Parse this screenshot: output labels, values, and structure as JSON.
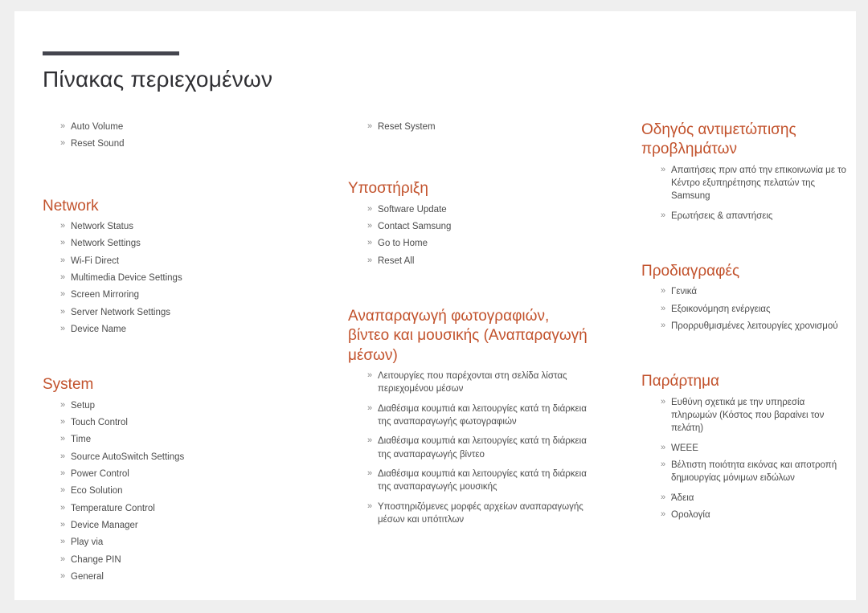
{
  "document": {
    "title": "Πίνακας περιεχομένων",
    "accent_color": "#c2522c",
    "rule_color": "#44454e",
    "body_text_color": "#4c4c4c",
    "page_background": "#ffffff",
    "canvas_background": "#efefef",
    "bullet_glyph": "»"
  },
  "columns": [
    {
      "name": "column-1",
      "sections": [
        {
          "heading": null,
          "items": [
            "Auto Volume",
            "Reset Sound"
          ]
        },
        {
          "heading": "Network",
          "items": [
            "Network Status",
            "Network Settings",
            "Wi-Fi Direct",
            "Multimedia Device Settings",
            "Screen Mirroring",
            "Server Network Settings",
            "Device Name"
          ]
        },
        {
          "heading": "System",
          "items": [
            "Setup",
            "Touch Control",
            "Time",
            "Source AutoSwitch Settings",
            "Power Control",
            "Eco Solution",
            "Temperature Control",
            "Device Manager",
            "Play via",
            "Change PIN",
            "General"
          ]
        }
      ]
    },
    {
      "name": "column-2",
      "sections": [
        {
          "heading": null,
          "items": [
            "Reset System"
          ]
        },
        {
          "heading": "Υποστήριξη",
          "items": [
            "Software Update",
            "Contact Samsung",
            "Go to Home",
            "Reset All"
          ]
        },
        {
          "heading": "Αναπαραγωγή φωτογραφιών, βίντεο και μουσικής (Αναπαραγωγή μέσων)",
          "items": [
            "Λειτουργίες που παρέχονται στη σελίδα λίστας περιεχομένου μέσων",
            "Διαθέσιμα κουμπιά και λειτουργίες κατά τη διάρκεια της αναπαραγωγής φωτογραφιών",
            "Διαθέσιμα κουμπιά και λειτουργίες κατά τη διάρκεια της αναπαραγωγής βίντεο",
            "Διαθέσιμα κουμπιά και λειτουργίες κατά τη διάρκεια της αναπαραγωγής μουσικής",
            "Υποστηριζόμενες μορφές αρχείων αναπαραγωγής μέσων και υπότιτλων"
          ]
        }
      ]
    },
    {
      "name": "column-3",
      "sections": [
        {
          "heading": "Οδηγός αντιμετώπισης προβλημάτων",
          "items": [
            "Απαιτήσεις πριν από την επικοινωνία με το Κέντρο εξυπηρέτησης πελατών της Samsung",
            "Ερωτήσεις & απαντήσεις"
          ]
        },
        {
          "heading": "Προδιαγραφές",
          "items": [
            "Γενικά",
            "Εξοικονόμηση ενέργειας",
            "Προρρυθμισμένες λειτουργίες χρονισμού"
          ]
        },
        {
          "heading": "Παράρτημα",
          "items": [
            "Ευθύνη σχετικά με την υπηρεσία πληρωμών (Κόστος που βαραίνει τον πελάτη)",
            "WEEE",
            "Βέλτιστη ποιότητα εικόνας και αποτροπή δημιουργίας μόνιμων ειδώλων",
            "Άδεια",
            "Ορολογία"
          ]
        }
      ]
    }
  ]
}
